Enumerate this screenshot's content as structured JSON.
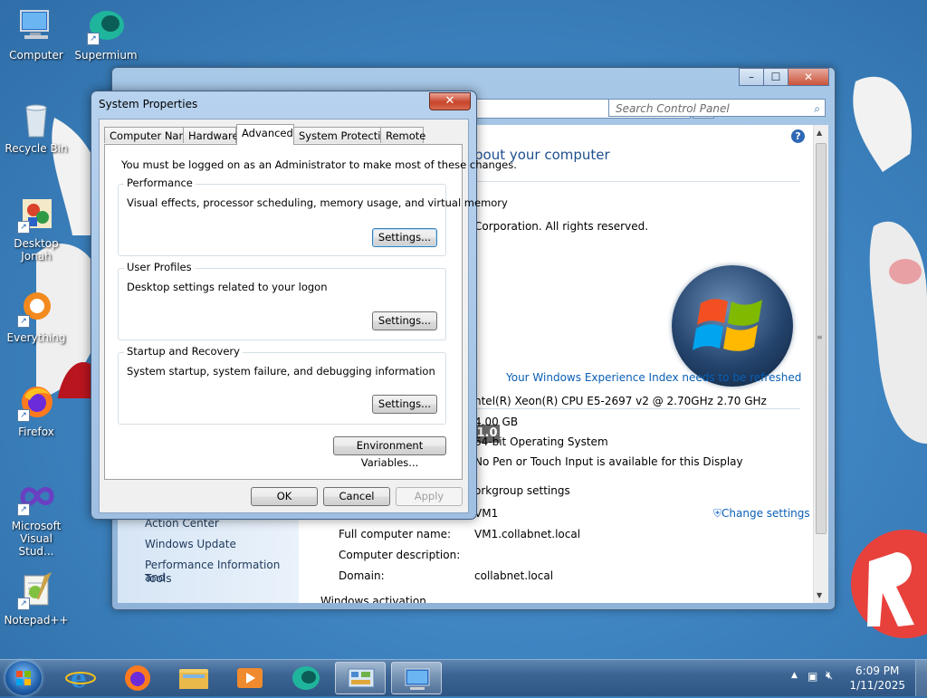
{
  "desktop": {
    "icons": [
      {
        "label_lines": [
          "Computer"
        ]
      },
      {
        "label_lines": [
          "Supermium"
        ]
      },
      {
        "label_lines": [
          "Recycle Bin"
        ]
      },
      {
        "label_lines": [
          "Desktop",
          "Jonah"
        ]
      },
      {
        "label_lines": [
          "Everything"
        ]
      },
      {
        "label_lines": [
          "Firefox"
        ]
      },
      {
        "label_lines": [
          "Microsoft",
          "Visual Stud..."
        ]
      },
      {
        "label_lines": [
          "Notepad++"
        ]
      }
    ]
  },
  "control_panel": {
    "search_placeholder": "Search Control Panel",
    "controls": {
      "minimize": "–",
      "maximize": "☐",
      "close": "✕"
    },
    "help": "?",
    "heading_partial": "bout your computer",
    "copyright_partial": "Corporation.  All rights reserved.",
    "rating_badge": "1.0",
    "rating_link": "Your Windows Experience Index needs to be refreshed",
    "processor_partial": "ntel(R) Xeon(R) CPU E5-2697 v2 @ 2.70GHz   2.70 GHz",
    "memory_partial": "4.00 GB",
    "system_type_partial": "64-bit Operating System",
    "pen_touch_partial": "No Pen or Touch Input is available for this Display",
    "workgroup_heading_partial": "orkgroup settings",
    "change_settings": "Change settings",
    "computer_name_partial": "VM1",
    "full_name_label": "Full computer name:",
    "full_name_value": "VM1.collabnet.local",
    "description_label": "Computer description:",
    "domain_label": "Domain:",
    "domain_value": "collabnet.local",
    "activation_partial": "Windows activation",
    "see_also": [
      "Action Center",
      "Windows Update",
      "Performance Information and",
      "Tools"
    ]
  },
  "system_properties": {
    "title": "System Properties",
    "close": "✕",
    "tabs": [
      "Computer Name",
      "Hardware",
      "Advanced",
      "System Protection",
      "Remote"
    ],
    "active_tab": "Advanced",
    "admin_note": "You must be logged on as an Administrator to make most of these changes.",
    "groups": [
      {
        "title": "Performance",
        "desc": "Visual effects, processor scheduling, memory usage, and virtual memory",
        "button": "Settings..."
      },
      {
        "title": "User Profiles",
        "desc": "Desktop settings related to your logon",
        "button": "Settings..."
      },
      {
        "title": "Startup and Recovery",
        "desc": "System startup, system failure, and debugging information",
        "button": "Settings..."
      }
    ],
    "env_button": "Environment Variables...",
    "ok": "OK",
    "cancel": "Cancel",
    "apply": "Apply"
  },
  "taskbar": {
    "time": "6:09 PM",
    "date": "1/11/2025",
    "tray_arrow": "▲"
  },
  "colors": {
    "desktop": "#3f86c3",
    "link": "#0a5fb4",
    "heading": "#1e4f8e",
    "taskbar": "#3c6594"
  }
}
